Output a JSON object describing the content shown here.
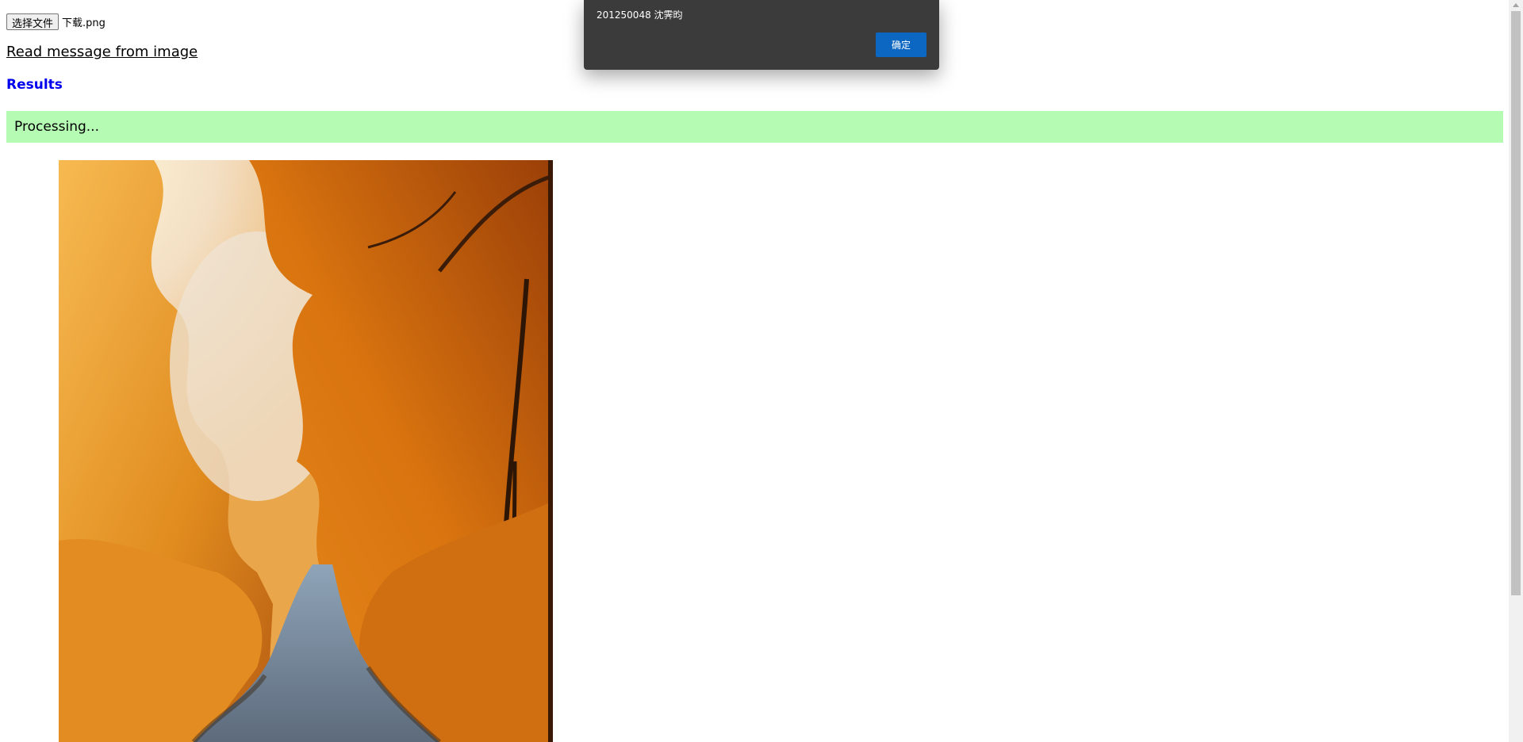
{
  "file_input": {
    "button_label": "选择文件",
    "file_name": "下载.png"
  },
  "read_link": "Read message from image",
  "results": {
    "heading": "Results",
    "status": "Processing..."
  },
  "dialog": {
    "message": "201250048 沈霁昀",
    "ok_label": "确定"
  },
  "colors": {
    "status_bg": "#b5fbb3",
    "heading": "#0000ee",
    "dialog_bg": "#3b3b3b",
    "dialog_button": "#0b67c2"
  }
}
